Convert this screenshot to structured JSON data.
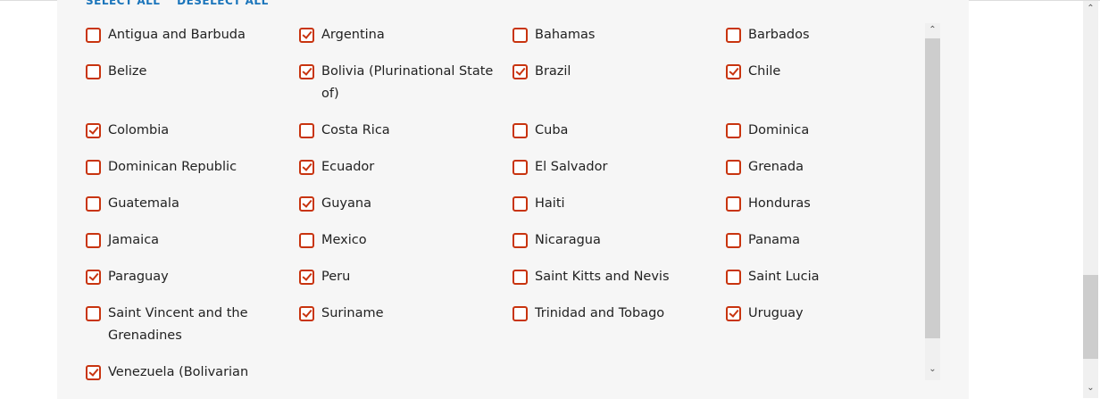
{
  "actions": {
    "select_all": "SELECT ALL",
    "deselect_all": "DESELECT ALL"
  },
  "accent_color": "#c8340f",
  "countries": [
    {
      "label": "Antigua and Barbuda",
      "checked": false
    },
    {
      "label": "Argentina",
      "checked": true
    },
    {
      "label": "Bahamas",
      "checked": false
    },
    {
      "label": "Barbados",
      "checked": false
    },
    {
      "label": "Belize",
      "checked": false
    },
    {
      "label": "Bolivia (Plurinational State of)",
      "checked": true
    },
    {
      "label": "Brazil",
      "checked": true
    },
    {
      "label": "Chile",
      "checked": true
    },
    {
      "label": "Colombia",
      "checked": true
    },
    {
      "label": "Costa Rica",
      "checked": false
    },
    {
      "label": "Cuba",
      "checked": false
    },
    {
      "label": "Dominica",
      "checked": false
    },
    {
      "label": "Dominican Republic",
      "checked": false
    },
    {
      "label": "Ecuador",
      "checked": true
    },
    {
      "label": "El Salvador",
      "checked": false
    },
    {
      "label": "Grenada",
      "checked": false
    },
    {
      "label": "Guatemala",
      "checked": false
    },
    {
      "label": "Guyana",
      "checked": true
    },
    {
      "label": "Haiti",
      "checked": false
    },
    {
      "label": "Honduras",
      "checked": false
    },
    {
      "label": "Jamaica",
      "checked": false
    },
    {
      "label": "Mexico",
      "checked": false
    },
    {
      "label": "Nicaragua",
      "checked": false
    },
    {
      "label": "Panama",
      "checked": false
    },
    {
      "label": "Paraguay",
      "checked": true
    },
    {
      "label": "Peru",
      "checked": true
    },
    {
      "label": "Saint Kitts and Nevis",
      "checked": false
    },
    {
      "label": "Saint Lucia",
      "checked": false
    },
    {
      "label": "Saint Vincent and the Grenadines",
      "checked": false
    },
    {
      "label": "Suriname",
      "checked": true
    },
    {
      "label": "Trinidad and Tobago",
      "checked": false
    },
    {
      "label": "Uruguay",
      "checked": true
    },
    {
      "label": "Venezuela (Bolivarian",
      "checked": true
    }
  ]
}
